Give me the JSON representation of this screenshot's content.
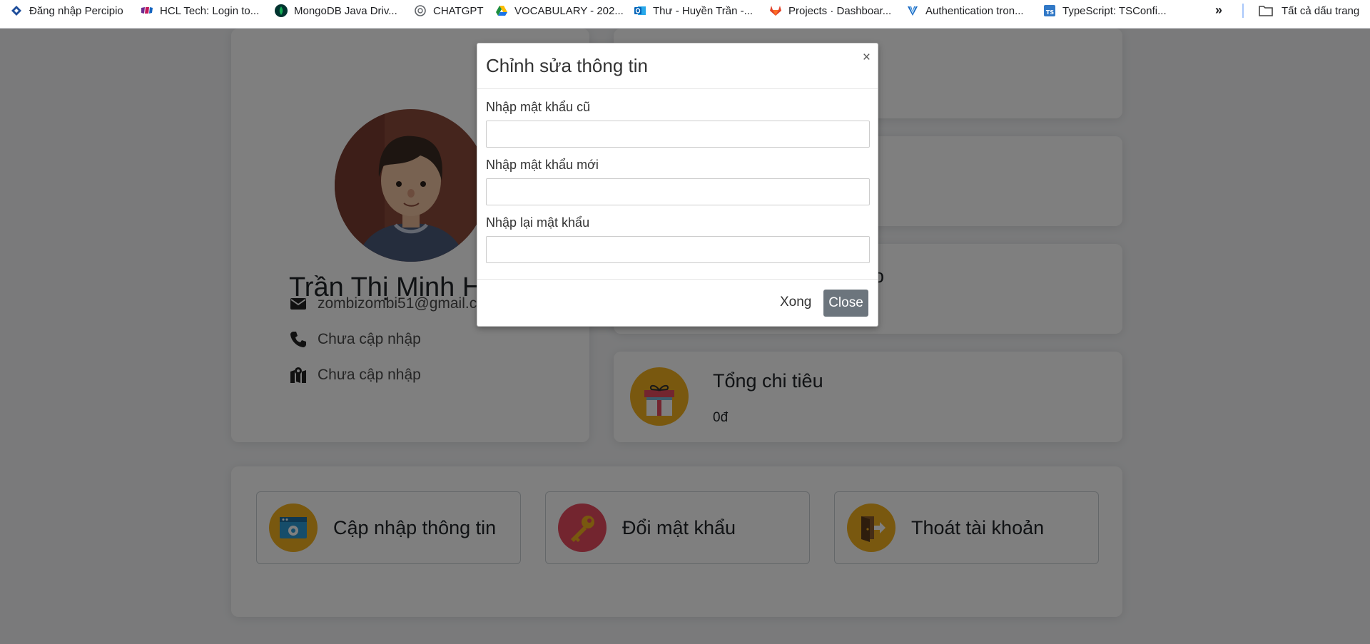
{
  "bookmarks": [
    {
      "label": "Đăng nhập Percipio",
      "icon": "percipio-icon"
    },
    {
      "label": "HCL Tech: Login to...",
      "icon": "hcl-icon"
    },
    {
      "label": "MongoDB Java Driv...",
      "icon": "mongodb-leaf-icon"
    },
    {
      "label": "CHATGPT",
      "icon": "chatgpt-icon"
    },
    {
      "label": "VOCABULARY - 202...",
      "icon": "google-drive-icon"
    },
    {
      "label": "Thư - Huyền Trần -...",
      "icon": "outlook-icon"
    },
    {
      "label": "Projects · Dashboar...",
      "icon": "gitlab-icon"
    },
    {
      "label": "Authentication tron...",
      "icon": "vuetify-icon"
    },
    {
      "label": "TypeScript: TSConfi...",
      "icon": "typescript-icon"
    }
  ],
  "bookmarks_more": "»",
  "all_bookmarks": "Tất cả dấu trang",
  "profile": {
    "name": "Trần Thị Minh H",
    "email": "zombizombi51@gmail.c",
    "phone": "Chưa cập nhập",
    "address": "Chưa cập nhập"
  },
  "stats": {
    "card3_title_fragment": "o",
    "total_spending_title": "Tổng chi tiêu",
    "total_spending_value": "0đ"
  },
  "actions": {
    "update_info": "Cập nhập thông tin",
    "change_password": "Đổi mật khẩu",
    "logout": "Thoát tài khoản"
  },
  "modal": {
    "title": "Chỉnh sửa thông tin",
    "close_symbol": "×",
    "old_password_label": "Nhập mật khẩu cũ",
    "new_password_label": "Nhập mật khẩu mới",
    "confirm_password_label": "Nhập lại mật khẩu",
    "old_password_value": "",
    "new_password_value": "",
    "confirm_password_value": "",
    "done_label": "Xong",
    "close_label": "Close"
  },
  "colors": {
    "backdrop": "rgba(0,0,0,0.5)",
    "close_button": "#6c757d",
    "icon_yellow": "#f2b01e",
    "icon_red": "#e64b5f"
  }
}
